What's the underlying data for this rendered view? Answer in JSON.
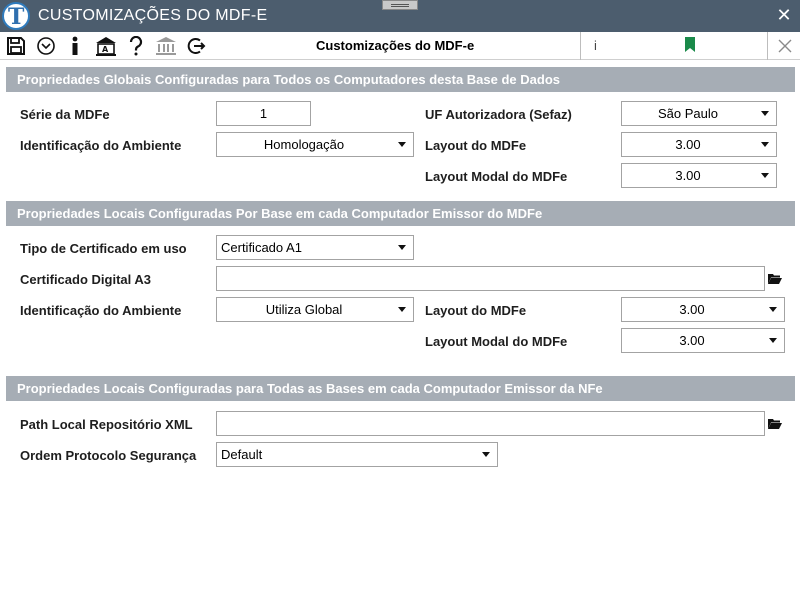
{
  "window": {
    "title": "CUSTOMIZAÇÕES DO MDF-E",
    "close_glyph": "✕"
  },
  "toolbar": {
    "title": "Customizações do MDF-e",
    "info_text": "i",
    "icons": [
      "save-icon",
      "dropdown-circle-icon",
      "info-icon",
      "bank-document-icon",
      "help-icon",
      "bank-icon",
      "logout-icon"
    ],
    "bookmark_color": "#1a8a4a"
  },
  "section1": {
    "header": "Propriedades Globais Configuradas para Todos os Computadores desta Base de Dados",
    "serie_label": "Série da MDFe",
    "serie_value": "1",
    "ambiente_label": "Identificação do Ambiente",
    "ambiente_value": "Homologação",
    "uf_label": "UF Autorizadora (Sefaz)",
    "uf_value": "São Paulo",
    "layout_label": "Layout do MDFe",
    "layout_value": "3.00",
    "layout_modal_label": "Layout Modal do MDFe",
    "layout_modal_value": "3.00"
  },
  "section2": {
    "header": "Propriedades Locais Configuradas Por Base em cada Computador Emissor do MDFe",
    "cert_tipo_label": "Tipo de Certificado em uso",
    "cert_tipo_value": "Certificado A1",
    "cert_a3_label": "Certificado Digital A3",
    "cert_a3_value": "",
    "ambiente_label": "Identificação do Ambiente",
    "ambiente_value": "Utiliza Global",
    "layout_label": "Layout do MDFe",
    "layout_value": "3.00",
    "layout_modal_label": "Layout Modal do MDFe",
    "layout_modal_value": "3.00"
  },
  "section3": {
    "header": "Propriedades Locais Configuradas para Todas as Bases em cada Computador Emissor da NFe",
    "path_label": "Path Local Repositório XML",
    "path_value": "",
    "protocolo_label": "Ordem Protocolo Segurança",
    "protocolo_value": "Default"
  },
  "colors": {
    "titlebar": "#4c5d6e",
    "section_header": "#a6adb5"
  }
}
